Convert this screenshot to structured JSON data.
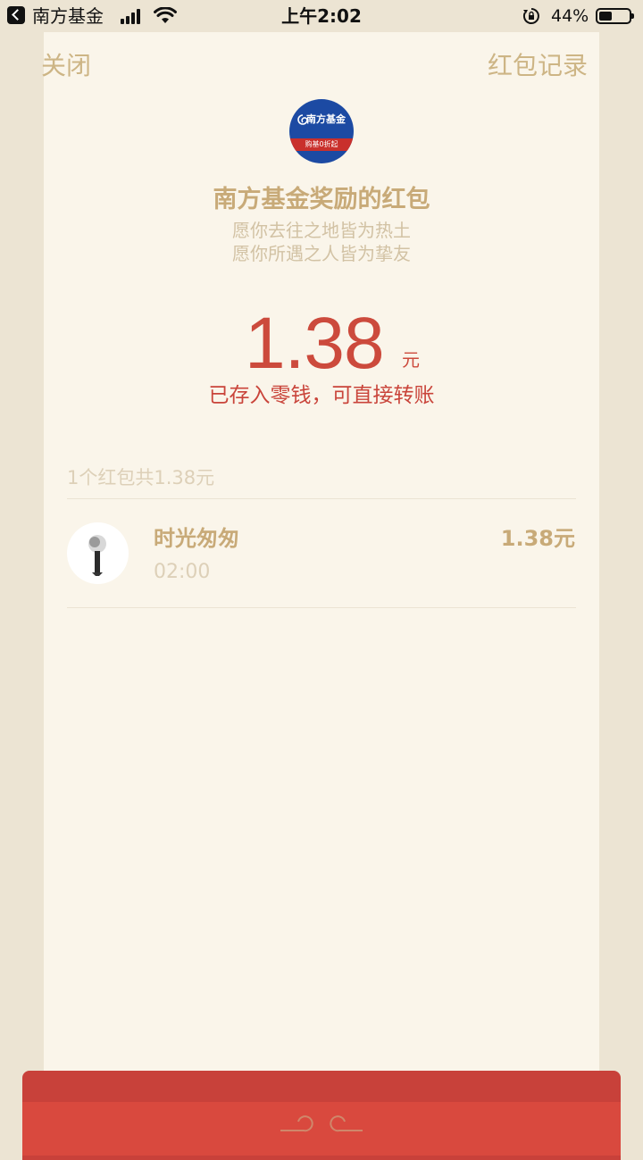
{
  "status_bar": {
    "app_name": "南方基金",
    "time": "上午2:02",
    "battery_percent": "44%",
    "battery_level": 0.44
  },
  "nav": {
    "close": "关闭",
    "record": "红包记录"
  },
  "logo": {
    "top_text": "南方基金",
    "bottom_text": "购基0折起"
  },
  "envelope": {
    "title": "南方基金奖励的红包",
    "wish_line1": "愿你去往之地皆为热土",
    "wish_line2": "愿你所遇之人皆为挚友",
    "amount": "1.38",
    "unit": "元",
    "stored_text": "已存入零钱，可直接转账"
  },
  "records": {
    "summary": "1个红包共1.38元",
    "items": [
      {
        "name": "时光匆匆",
        "time": "02:00",
        "amount": "1.38元"
      }
    ]
  },
  "colors": {
    "gold": "#c8aa78",
    "red": "#cc4a3c",
    "card_bg": "#faf5ea",
    "page_bg": "#ece4d3"
  }
}
